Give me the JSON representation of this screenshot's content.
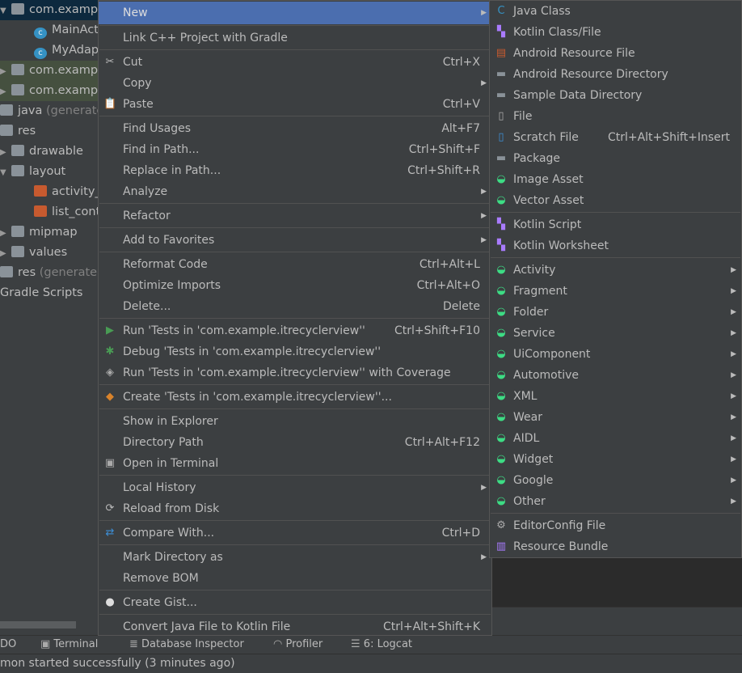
{
  "tree": [
    {
      "label": "com.examp",
      "arrow": "▼",
      "icon": "folder-icon",
      "state": "sel",
      "indent": 0
    },
    {
      "label": "MainAct",
      "icon": "class-icon",
      "indent": 1
    },
    {
      "label": "MyAdap",
      "icon": "class-icon",
      "indent": 1
    },
    {
      "label": "com.examp",
      "arrow": "▶",
      "icon": "folder-icon",
      "state": "grn",
      "indent": 0
    },
    {
      "label": "com.examp",
      "arrow": "▶",
      "icon": "folder-icon",
      "state": "grn",
      "indent": 0
    },
    {
      "label": "java",
      "suffix": " (generate",
      "icon": "generated-folder-icon",
      "indent": -1
    },
    {
      "label": "res",
      "icon": "res-folder-icon",
      "indent": -1
    },
    {
      "label": "drawable",
      "arrow": "▶",
      "icon": "folder-icon",
      "indent": 0
    },
    {
      "label": "layout",
      "arrow": "▼",
      "icon": "folder-icon",
      "indent": 0
    },
    {
      "label": "activity_",
      "icon": "xml-file-icon",
      "indent": 1
    },
    {
      "label": "list_cont",
      "icon": "xml-file-icon",
      "indent": 1
    },
    {
      "label": "mipmap",
      "arrow": "▶",
      "icon": "folder-icon",
      "indent": 0
    },
    {
      "label": "values",
      "arrow": "▶",
      "icon": "folder-icon",
      "indent": 0
    },
    {
      "label": "res",
      "suffix": " (generated",
      "icon": "res-folder-icon",
      "indent": -1
    },
    {
      "label": "Gradle Scripts",
      "indent": -2
    }
  ],
  "menu": [
    {
      "label": "New",
      "submenu": true,
      "highlighted": true
    },
    {
      "sep": true
    },
    {
      "label": "Link C++ Project with Gradle"
    },
    {
      "sep": true
    },
    {
      "label": "Cut",
      "shortcut": "Ctrl+X",
      "icon": "cut-icon",
      "glyph": "✂"
    },
    {
      "label": "Copy",
      "submenu": true
    },
    {
      "label": "Paste",
      "shortcut": "Ctrl+V",
      "icon": "paste-icon",
      "glyph": "📋"
    },
    {
      "sep": true
    },
    {
      "label": "Find Usages",
      "shortcut": "Alt+F7"
    },
    {
      "label": "Find in Path...",
      "shortcut": "Ctrl+Shift+F"
    },
    {
      "label": "Replace in Path...",
      "shortcut": "Ctrl+Shift+R"
    },
    {
      "label": "Analyze",
      "submenu": true
    },
    {
      "sep": true
    },
    {
      "label": "Refactor",
      "submenu": true
    },
    {
      "sep": true
    },
    {
      "label": "Add to Favorites",
      "submenu": true
    },
    {
      "sep": true
    },
    {
      "label": "Reformat Code",
      "shortcut": "Ctrl+Alt+L"
    },
    {
      "label": "Optimize Imports",
      "shortcut": "Ctrl+Alt+O"
    },
    {
      "label": "Delete...",
      "shortcut": "Delete"
    },
    {
      "sep": true
    },
    {
      "label": "Run 'Tests in 'com.example.itrecyclerview''",
      "shortcut": "Ctrl+Shift+F10",
      "icon": "run-icon",
      "glyph": "▶",
      "color": "#499c54"
    },
    {
      "label": "Debug 'Tests in 'com.example.itrecyclerview''",
      "icon": "debug-icon",
      "glyph": "✱",
      "color": "#499c54"
    },
    {
      "label": "Run 'Tests in 'com.example.itrecyclerview'' with Coverage",
      "icon": "coverage-icon",
      "glyph": "◈",
      "color": "#aaa"
    },
    {
      "sep": true
    },
    {
      "label": "Create 'Tests in 'com.example.itrecyclerview''...",
      "icon": "create-test-icon",
      "glyph": "◆",
      "color": "#d9832b"
    },
    {
      "sep": true
    },
    {
      "label": "Show in Explorer"
    },
    {
      "label": "Directory Path",
      "shortcut": "Ctrl+Alt+F12"
    },
    {
      "label": "Open in Terminal",
      "icon": "terminal-icon",
      "glyph": "▣",
      "color": "#aaa"
    },
    {
      "sep": true
    },
    {
      "label": "Local History",
      "submenu": true
    },
    {
      "label": "Reload from Disk",
      "icon": "reload-icon",
      "glyph": "⟳",
      "color": "#bbb"
    },
    {
      "sep": true
    },
    {
      "label": "Compare With...",
      "shortcut": "Ctrl+D",
      "icon": "compare-icon",
      "glyph": "⇄",
      "color": "#3d8fd6"
    },
    {
      "sep": true
    },
    {
      "label": "Mark Directory as",
      "submenu": true
    },
    {
      "label": "Remove BOM"
    },
    {
      "sep": true
    },
    {
      "label": "Create Gist...",
      "icon": "github-icon",
      "glyph": "●",
      "color": "#ddd"
    },
    {
      "sep": true
    },
    {
      "label": "Convert Java File to Kotlin File",
      "shortcut": "Ctrl+Alt+Shift+K"
    }
  ],
  "submenu": [
    {
      "label": "Java Class",
      "icon": "java-class-icon",
      "glyph": "C",
      "color": "#3592c4"
    },
    {
      "label": "Kotlin Class/File",
      "icon": "kotlin-file-icon",
      "glyph": "▚",
      "color": "#a97bff"
    },
    {
      "label": "Android Resource File",
      "icon": "android-resource-file-icon",
      "glyph": "▤",
      "color": "#c75a2f"
    },
    {
      "label": "Android Resource Directory",
      "icon": "folder-icon",
      "glyph": "▬",
      "color": "#8a9299"
    },
    {
      "label": "Sample Data Directory",
      "icon": "folder-icon",
      "glyph": "▬",
      "color": "#8a9299"
    },
    {
      "label": "File",
      "icon": "file-icon",
      "glyph": "▯",
      "color": "#aaa"
    },
    {
      "label": "Scratch File",
      "shortcut": "Ctrl+Alt+Shift+Insert",
      "icon": "scratch-file-icon",
      "glyph": "▯",
      "color": "#3d8fd6"
    },
    {
      "label": "Package",
      "icon": "package-icon",
      "glyph": "▬",
      "color": "#8a9299"
    },
    {
      "label": "Image Asset",
      "icon": "android-icon",
      "glyph": "◒",
      "color": "#3ddc84"
    },
    {
      "label": "Vector Asset",
      "icon": "android-icon",
      "glyph": "◒",
      "color": "#3ddc84"
    },
    {
      "sep": true
    },
    {
      "label": "Kotlin Script",
      "icon": "kotlin-script-icon",
      "glyph": "▚",
      "color": "#a97bff"
    },
    {
      "label": "Kotlin Worksheet",
      "icon": "kotlin-worksheet-icon",
      "glyph": "▚",
      "color": "#a97bff"
    },
    {
      "sep": true
    },
    {
      "label": "Activity",
      "submenu": true,
      "icon": "android-icon",
      "glyph": "◒",
      "color": "#3ddc84"
    },
    {
      "label": "Fragment",
      "submenu": true,
      "icon": "android-icon",
      "glyph": "◒",
      "color": "#3ddc84"
    },
    {
      "label": "Folder",
      "submenu": true,
      "icon": "android-icon",
      "glyph": "◒",
      "color": "#3ddc84"
    },
    {
      "label": "Service",
      "submenu": true,
      "icon": "android-icon",
      "glyph": "◒",
      "color": "#3ddc84"
    },
    {
      "label": "UiComponent",
      "submenu": true,
      "icon": "android-icon",
      "glyph": "◒",
      "color": "#3ddc84"
    },
    {
      "label": "Automotive",
      "submenu": true,
      "icon": "android-icon",
      "glyph": "◒",
      "color": "#3ddc84"
    },
    {
      "label": "XML",
      "submenu": true,
      "icon": "android-icon",
      "glyph": "◒",
      "color": "#3ddc84"
    },
    {
      "label": "Wear",
      "submenu": true,
      "icon": "android-icon",
      "glyph": "◒",
      "color": "#3ddc84"
    },
    {
      "label": "AIDL",
      "submenu": true,
      "icon": "android-icon",
      "glyph": "◒",
      "color": "#3ddc84"
    },
    {
      "label": "Widget",
      "submenu": true,
      "icon": "android-icon",
      "glyph": "◒",
      "color": "#3ddc84"
    },
    {
      "label": "Google",
      "submenu": true,
      "icon": "android-icon",
      "glyph": "◒",
      "color": "#3ddc84"
    },
    {
      "label": "Other",
      "submenu": true,
      "icon": "android-icon",
      "glyph": "◒",
      "color": "#3ddc84"
    },
    {
      "sep": true
    },
    {
      "label": "EditorConfig File",
      "icon": "gear-icon",
      "glyph": "⚙",
      "color": "#aaa"
    },
    {
      "label": "Resource Bundle",
      "icon": "resource-bundle-icon",
      "glyph": "▥",
      "color": "#a97bff"
    }
  ],
  "toolbar": [
    {
      "label": "DO",
      "icon": ""
    },
    {
      "label": "Terminal",
      "icon": "terminal-icon",
      "glyph": "▣"
    },
    {
      "label": "Database Inspector",
      "icon": "database-icon",
      "glyph": "≣"
    },
    {
      "label": "Profiler",
      "icon": "profiler-icon",
      "glyph": "◠"
    },
    {
      "label": "6: Logcat",
      "icon": "logcat-icon",
      "glyph": "☰"
    }
  ],
  "status": "mon started successfully (3 minutes ago)"
}
